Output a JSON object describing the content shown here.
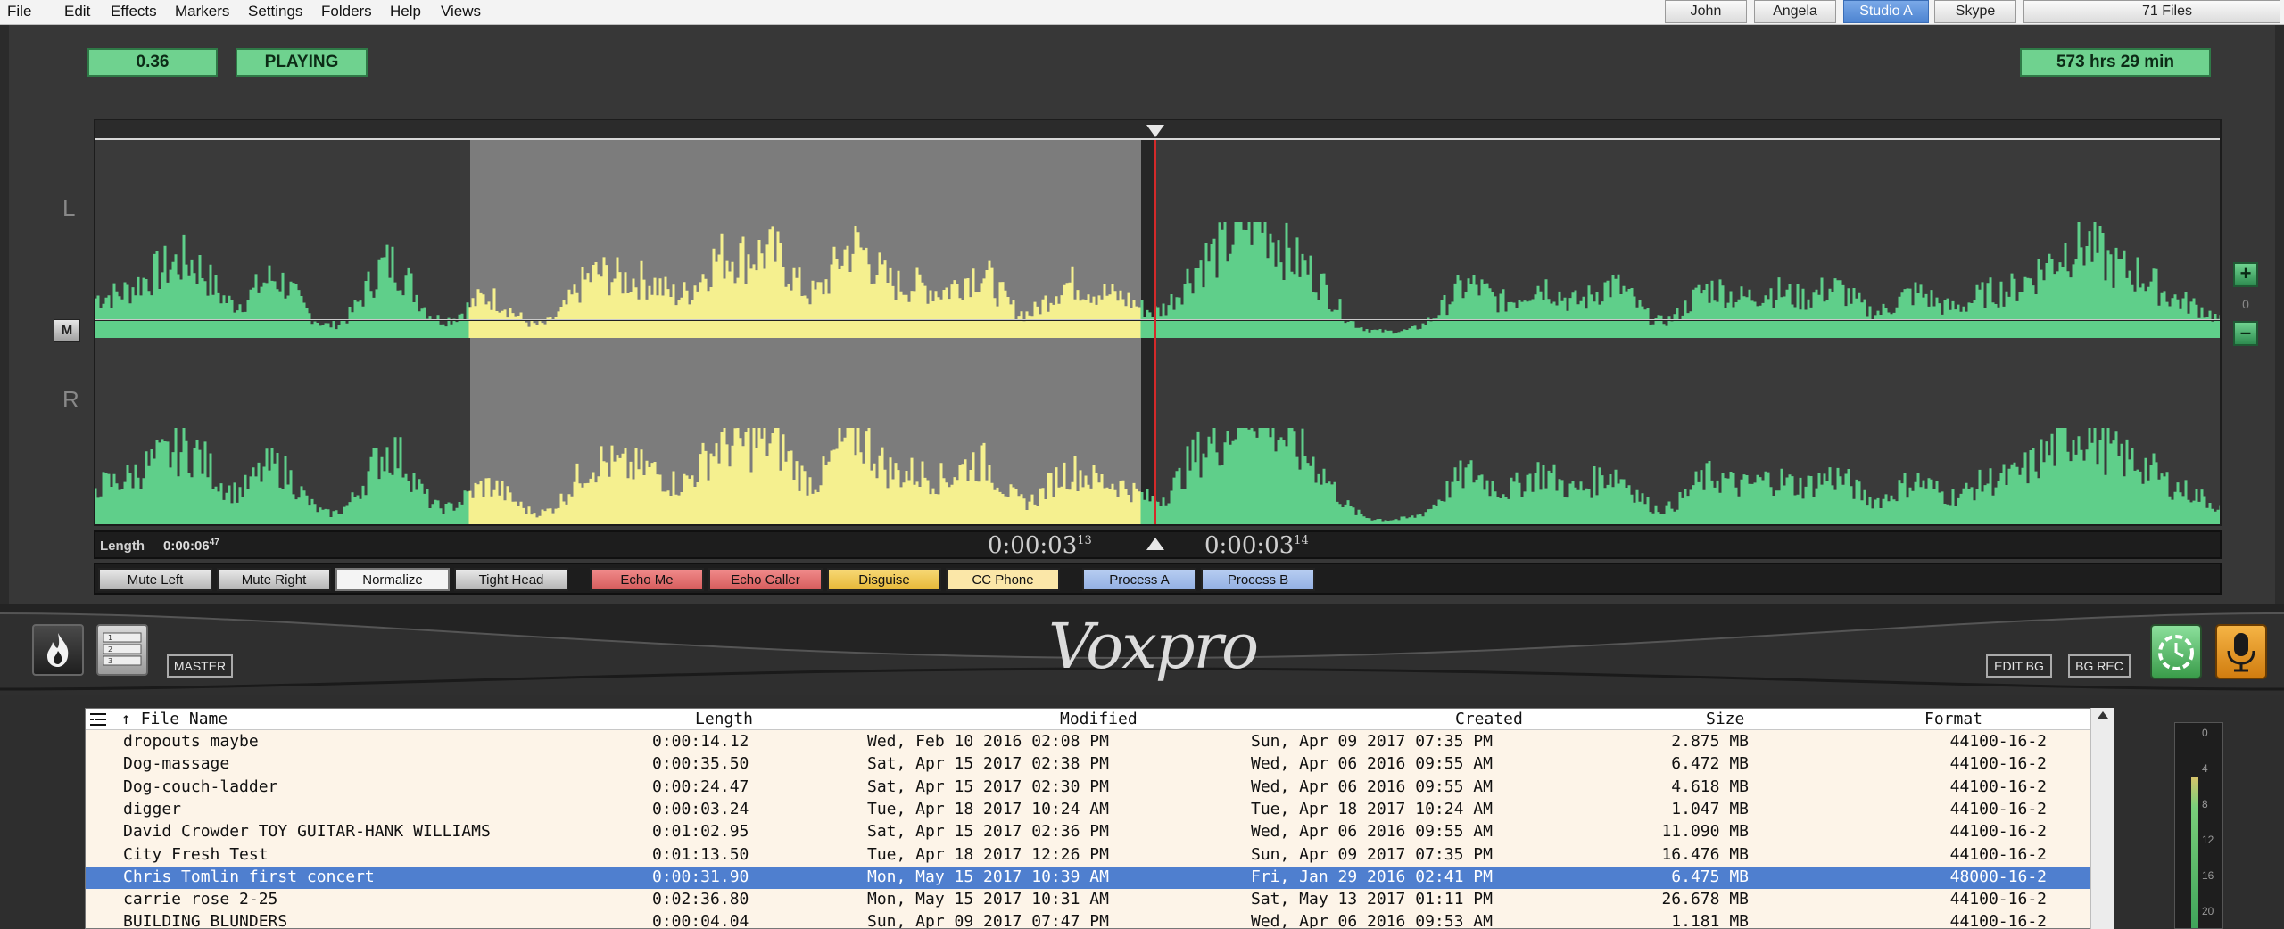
{
  "menu": [
    "File",
    "Edit",
    "Effects",
    "Markers",
    "Settings",
    "Folders",
    "Help",
    "Views"
  ],
  "user_tabs": [
    {
      "label": "John",
      "active": false
    },
    {
      "label": "Angela",
      "active": false
    },
    {
      "label": "Studio A",
      "active": true
    },
    {
      "label": "Skype",
      "active": false
    }
  ],
  "files_count": "71 Files",
  "status": {
    "level": "0.36",
    "state": "PLAYING",
    "total_time": "573 hrs  29 min"
  },
  "channels": {
    "left": "L",
    "right": "R"
  },
  "mute_button": "M",
  "zoom": {
    "plus": "+",
    "level": "0",
    "minus": "–"
  },
  "timeline": {
    "length_label": "Length",
    "length_value": "0:00:06",
    "length_frames": "47",
    "cursor_left": "0:00:03",
    "cursor_left_frames": "13",
    "cursor_right": "0:00:03",
    "cursor_right_frames": "14"
  },
  "effects": [
    {
      "label": "Mute Left",
      "style": "gray"
    },
    {
      "label": "Mute Right",
      "style": "gray"
    },
    {
      "label": "Normalize",
      "style": "white"
    },
    {
      "label": "Tight Head",
      "style": "gray"
    },
    {
      "label": "Echo Me",
      "style": "red"
    },
    {
      "label": "Echo Caller",
      "style": "red"
    },
    {
      "label": "Disguise",
      "style": "yellow"
    },
    {
      "label": "CC Phone",
      "style": "cream"
    },
    {
      "label": "Process A",
      "style": "blue"
    },
    {
      "label": "Process B",
      "style": "blue"
    }
  ],
  "brand": {
    "logo": "Voxpro",
    "master_label": "MASTER",
    "edit_bg_label": "EDIT BG",
    "bg_rec_label": "BG REC"
  },
  "file_list": {
    "columns": {
      "name": "File Name",
      "length": "Length",
      "modified": "Modified",
      "created": "Created",
      "size": "Size",
      "format": "Format"
    },
    "sort_indicator": "↑",
    "rows": [
      {
        "name": "dropouts maybe",
        "length": "0:00:14.12",
        "modified": "Wed, Feb 10 2016  02:08 PM",
        "created": "Sun, Apr 09 2017  07:35 PM",
        "size": "2.875 MB",
        "format": "44100-16-2",
        "selected": false
      },
      {
        "name": "Dog-massage",
        "length": "0:00:35.50",
        "modified": "Sat, Apr 15 2017  02:38 PM",
        "created": "Wed, Apr 06 2016  09:55 AM",
        "size": "6.472 MB",
        "format": "44100-16-2",
        "selected": false
      },
      {
        "name": "Dog-couch-ladder",
        "length": "0:00:24.47",
        "modified": "Sat, Apr 15 2017  02:30 PM",
        "created": "Wed, Apr 06 2016  09:55 AM",
        "size": "4.618 MB",
        "format": "44100-16-2",
        "selected": false
      },
      {
        "name": "digger",
        "length": "0:00:03.24",
        "modified": "Tue, Apr 18 2017  10:24 AM",
        "created": "Tue, Apr 18 2017  10:24 AM",
        "size": "1.047 MB",
        "format": "44100-16-2",
        "selected": false
      },
      {
        "name": "David Crowder TOY GUITAR-HANK WILLIAMS",
        "length": "0:01:02.95",
        "modified": "Sat, Apr 15 2017  02:36 PM",
        "created": "Wed, Apr 06 2016  09:55 AM",
        "size": "11.090 MB",
        "format": "44100-16-2",
        "selected": false
      },
      {
        "name": "City Fresh Test",
        "length": "0:01:13.50",
        "modified": "Tue, Apr 18 2017  12:26 PM",
        "created": "Sun, Apr 09 2017  07:35 PM",
        "size": "16.476 MB",
        "format": "44100-16-2",
        "selected": false
      },
      {
        "name": "Chris Tomlin first concert",
        "length": "0:00:31.90",
        "modified": "Mon, May 15 2017  10:39 AM",
        "created": "Fri, Jan 29 2016  02:41 PM",
        "size": "6.475 MB",
        "format": "48000-16-2",
        "selected": true
      },
      {
        "name": "carrie rose 2-25",
        "length": "0:02:36.80",
        "modified": "Mon, May 15 2017  10:31 AM",
        "created": "Sat, May 13 2017  01:11 PM",
        "size": "26.678 MB",
        "format": "44100-16-2",
        "selected": false
      },
      {
        "name": "BUILDING BLUNDERS",
        "length": "0:00:04.04",
        "modified": "Sun, Apr 09 2017  07:47 PM",
        "created": "Wed, Apr 06 2016  09:53 AM",
        "size": "1.181 MB",
        "format": "44100-16-2",
        "selected": false
      }
    ]
  },
  "meter_ticks": [
    "0",
    "4",
    "8",
    "12",
    "16",
    "20"
  ],
  "colors": {
    "waveform_green": "#5fcf8a",
    "waveform_selected": "#f5f08f",
    "selection_bg": "#7c7c7c",
    "playhead": "#d42a2a",
    "selected_row": "#4f7fcf"
  }
}
